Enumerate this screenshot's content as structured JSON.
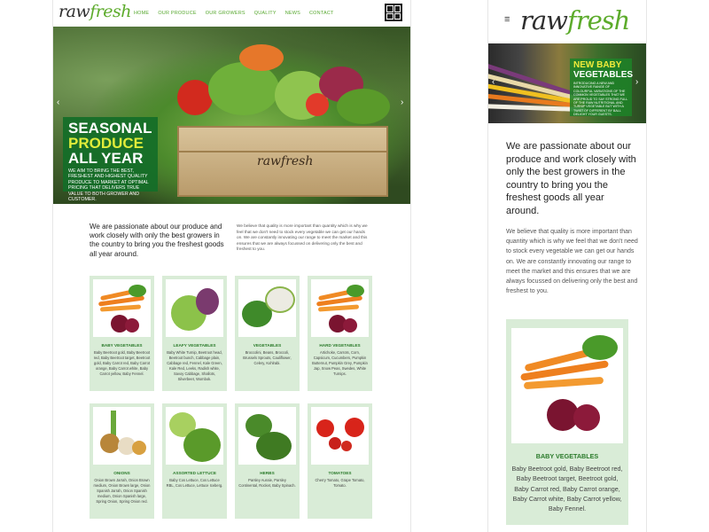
{
  "brand": {
    "logo_a": "raw",
    "logo_b": "fresh",
    "crate_text": "rawfresh"
  },
  "nav": [
    "HOME",
    "OUR PRODUCE",
    "OUR GROWERS",
    "QUALITY",
    "NEWS",
    "CONTACT"
  ],
  "hero": {
    "line1": "SEASONAL",
    "line2": "PRODUCE",
    "line3": "ALL YEAR",
    "subtitle": "WE AIM TO BRING THE BEST, FRESHEST AND HIGHEST QUALITY PRODUCE TO MARKET AT OPTIMAL PRICING THAT DELIVERS TRUE VALUE TO BOTH GROWER AND CUSTOMER."
  },
  "intro": {
    "lead": "We are passionate about our produce and work closely with only the best growers in the country to bring you the freshest goods all year around.",
    "body": "We believe that quality is more important than quantity which is why we feel that we don't need to stock every vegetable we can get our hands on. We are constantly innovating our range to meet the market and this ensures that we are always focussed on delivering only the best and freshest to you."
  },
  "categories": [
    {
      "title": "BABY VEGETABLES",
      "desc": "Baby Beetroot gold, Baby Beetroot red, Baby Beetroot target, Beetroot gold, Baby Carrot red, Baby Carrot orange, Baby Carrot white, Baby Carrot yellow, Baby Fennel."
    },
    {
      "title": "LEAFY VEGETABLES",
      "desc": "Baby White Turnip, Beetroot head, Beetroot bunch, Cabbage plain, Cabbage red, Fennel, Kale Green, Kale Red, Leeks, Radish white, Savoy Cabbage, Shallots, Silverbeet, Wombok."
    },
    {
      "title": "VEGETABLES",
      "desc": "Broccolini, Beans, Broccoli, Brussels Sprouts, Cauliflower, Celery, Kohlrabi."
    },
    {
      "title": "HARD VEGETABLES",
      "desc": "Artichoke, Carrots, Corn, Capsicum, Cucumbers, Pumpkin Butternut, Pumpkin Grey, Pumpkin Jap, Snow Peas, Swedes, White Turnips."
    },
    {
      "title": "ONIONS",
      "desc": "Onion Brown Jarrah, Onion Brown medium, Onion Brown large, Onion Spanish Jarrah, Onion Spanish medium, Onion Spanish large, Spring Onion, Spring Onion red."
    },
    {
      "title": "ASSORTED LETTUCE",
      "desc": "Baby Cos Lettuce, Cos Lettuce RBL, Cos Lettuce, Lettuce Iceberg."
    },
    {
      "title": "HERBS",
      "desc": "Parsley Aussie, Parsley Continental, Rocket, Baby Spinach."
    },
    {
      "title": "TOMATOES",
      "desc": "Cherry Tomato, Grape Tomato, Tomato."
    }
  ],
  "mobile": {
    "hero_line1": "NEW BABY",
    "hero_line2": "VEGETABLES",
    "hero_sub": "INTRODUCING A NEW AND INNOVATIVE RANGE OF COLOURFUL VARIATIONS OF THE COMMON VEGETABLES THAT WE ARE PROUD TO SAY STRONG FULL OF THE RAW NUTRITIONAL AND TURNIP VEGETABLE BUT WITH A TWIST OF DIFFERENT BY BALL DELIGHT YOUR GUESTS.",
    "card_title": "BABY VEGETABLES",
    "card_desc": "Baby Beetroot gold, Baby Beetroot red, Baby Beetroot target, Beetroot gold, Baby Carrot red, Baby Carrot orange, Baby Carrot white, Baby Carrot yellow, Baby Fennel."
  },
  "colors": {
    "brand_green": "#5cab2b",
    "card_bg": "#d9ecd7",
    "hero_box": "#146e28",
    "hero_yellow": "#e0ec3a"
  }
}
